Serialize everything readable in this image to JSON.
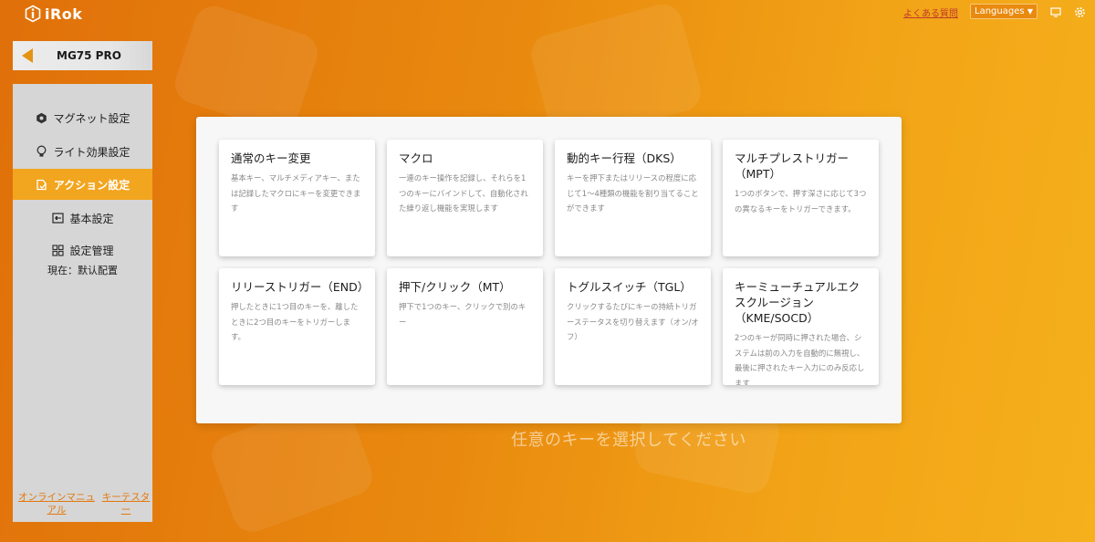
{
  "topbar": {
    "logo_text": "iRok",
    "faq_label": "よくある質問",
    "language_label": "Languages",
    "icons": [
      "window-icon",
      "gear-icon"
    ]
  },
  "device": {
    "name": "MG75 PRO"
  },
  "sidebar": {
    "items": [
      {
        "label": "マグネット設定",
        "icon": "magnet-hex-icon",
        "active": false
      },
      {
        "label": "ライト効果設定",
        "icon": "lightbulb-icon",
        "active": false
      },
      {
        "label": "アクション設定",
        "icon": "action-icon",
        "active": true
      },
      {
        "label": "基本設定",
        "icon": "settings-panel-icon",
        "active": false
      },
      {
        "label": "設定管理",
        "icon": "grid-icon",
        "active": false
      }
    ],
    "current_profile": "現在：默认配置"
  },
  "footer": {
    "manual_label": "オンラインマニュアル",
    "tester_label": "キーテスター"
  },
  "cards": [
    {
      "title": "通常のキー変更",
      "desc": "基本キー、マルチメディアキー、または記録したマクロにキーを変更できます"
    },
    {
      "title": "マクロ",
      "desc": "一連のキー操作を記録し、それらを1つのキーにバインドして、自動化された繰り返し機能を実現します"
    },
    {
      "title": "動的キー行程（DKS）",
      "desc": "キーを押下またはリリースの程度に応じて1～4種類の機能を割り当てることができます"
    },
    {
      "title": "マルチプレストリガー（MPT）",
      "desc": "1つのボタンで、押す深さに応じて3つの異なるキーをトリガーできます。"
    },
    {
      "title": "リリーストリガー（END）",
      "desc": "押したときに1つ目のキーを、離したときに2つ目のキーをトリガーします。"
    },
    {
      "title": "押下/クリック（MT）",
      "desc": "押下で1つのキー、クリックで別のキー"
    },
    {
      "title": "トグルスイッチ（TGL）",
      "desc": "クリックするたびにキーの持続トリガーステータスを切り替えます（オン/オフ）"
    },
    {
      "title": "キーミューチュアルエクスクルージョン（KME/SOCD）",
      "desc": "2つのキーが同時に押された場合、システムは前の入力を自動的に無視し、最後に押されたキー入力にのみ反応します"
    }
  ],
  "hint": "任意のキーを選択してください",
  "colors": {
    "accent": "#f2a51f",
    "background_start": "#e0700a",
    "background_end": "#f5b01c"
  }
}
